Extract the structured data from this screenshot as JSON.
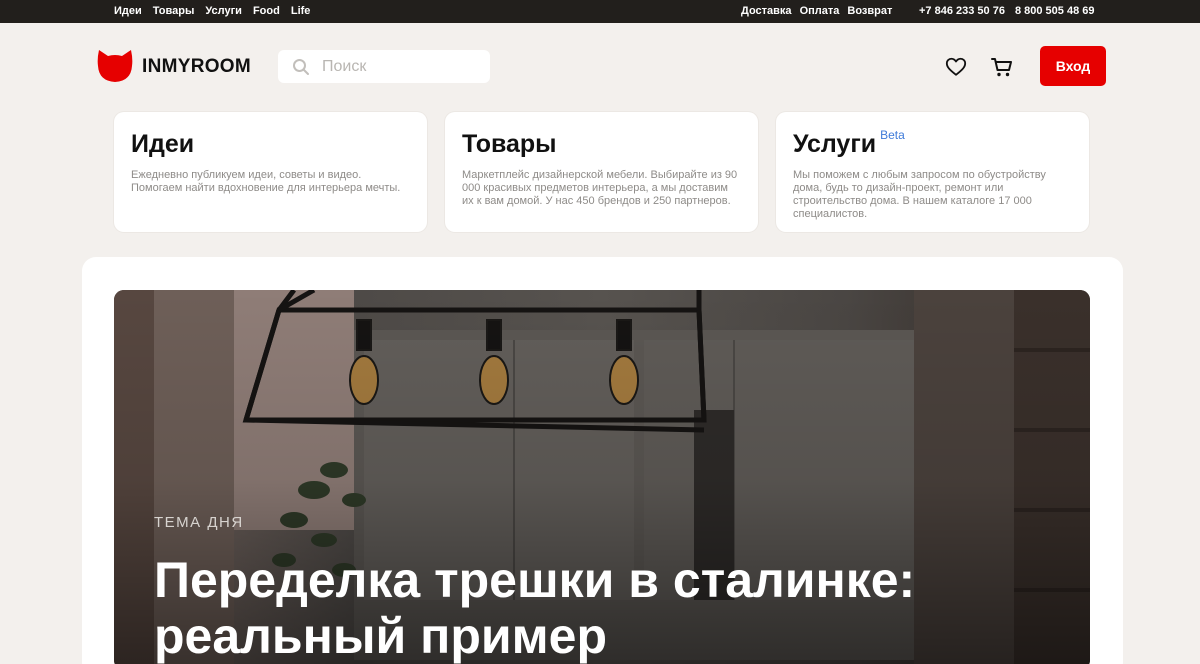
{
  "topbar": {
    "nav": [
      "Идеи",
      "Товары",
      "Услуги",
      "Food",
      "Life"
    ],
    "service": [
      "Доставка",
      "Оплата",
      "Возврат"
    ],
    "phones": [
      "+7 846 233 50 76",
      "8 800 505 48 69"
    ]
  },
  "header": {
    "brand": "INMYROOM",
    "search_placeholder": "Поиск",
    "login_label": "Вход",
    "brand_color": "#e60000"
  },
  "cards": [
    {
      "title": "Идеи",
      "badge": "",
      "desc": "Ежедневно публикуем идеи, советы и видео. Помогаем найти вдохновение для интерьера мечты."
    },
    {
      "title": "Товары",
      "badge": "",
      "desc": "Маркетплейс дизайнерской мебели. Выбирайте из 90 000 красивых предметов интерьера, а мы доставим их к вам домой. У нас 450 брендов и 250 партнеров."
    },
    {
      "title": "Услуги",
      "badge": "Beta",
      "desc": "Мы поможем с любым запросом по обустройству дома, будь то дизайн-проект, ремонт или строительство дома. В нашем каталоге 17 000 специалистов."
    }
  ],
  "hero": {
    "kicker": "ТЕМА ДНЯ",
    "headline": "Переделка трешки в сталинке: реальный пример"
  }
}
